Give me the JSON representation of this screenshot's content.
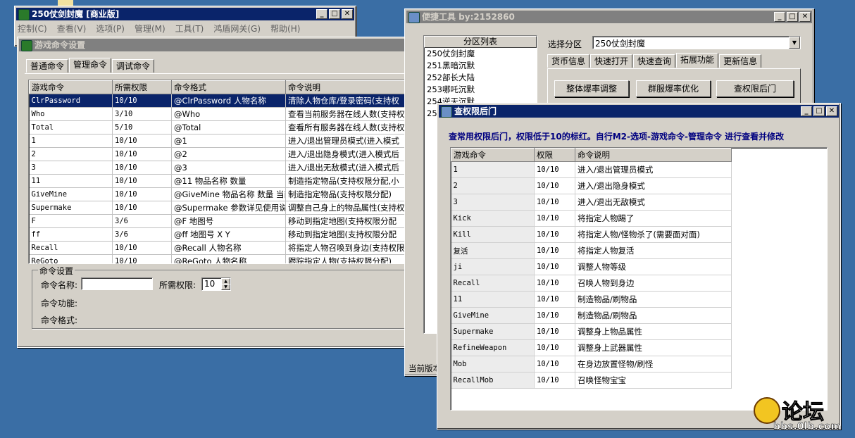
{
  "main_window": {
    "title": "250仗剑封魔 [商业版]",
    "menu": [
      "控制(C)",
      "查看(V)",
      "选项(P)",
      "管理(M)",
      "工具(T)",
      "鸿盾网关(G)",
      "帮助(H)"
    ]
  },
  "cmd_dialog": {
    "title": "游戏命令设置",
    "tabs": [
      "普通命令",
      "管理命令",
      "调试命令"
    ],
    "selected_tab": "管理命令",
    "table": {
      "headers": [
        "游戏命令",
        "所需权限",
        "命令格式",
        "命令说明"
      ],
      "rows": [
        [
          "ClrPassword",
          "10/10",
          "@ClrPassword 人物名称",
          "清除人物仓库/登录密码(支持权"
        ],
        [
          "Who",
          "3/10",
          "@Who",
          "查看当前服务器在线人数(支持权"
        ],
        [
          "Total",
          "5/10",
          "@Total",
          "查看所有服务器在线人数(支持权"
        ],
        [
          "1",
          "10/10",
          "@1",
          "进入/退出管理员模式(进入模式"
        ],
        [
          "2",
          "10/10",
          "@2",
          "进入/退出隐身模式(进入模式后"
        ],
        [
          "3",
          "10/10",
          "@3",
          "进入/退出无敌模式(进入模式后"
        ],
        [
          "11",
          "10/10",
          "@11 物品名称 数量",
          "制造指定物品(支持权限分配,小"
        ],
        [
          "GiveMine",
          "10/10",
          "@GiveMine 物品名称 数量 当前",
          "制造指定物品(支持权限分配)"
        ],
        [
          "Supermake",
          "10/10",
          "@Supermake 参数详见使用说明",
          "调整自己身上的物品属性(支持权"
        ],
        [
          "F",
          "3/6",
          "@F 地图号",
          "移动到指定地图(支持权限分配"
        ],
        [
          "ff",
          "3/6",
          "@ff 地图号 X Y",
          "移动到指定地图(支持权限分配"
        ],
        [
          "Recall",
          "10/10",
          "@Recall 人物名称",
          "将指定人物召唤到身边(支持权限"
        ],
        [
          "ReGoto",
          "10/10",
          "@ReGoto 人物名称",
          "跟踪指定人物(支持权限分配)"
        ]
      ]
    },
    "settings": {
      "group_label": "命令设置",
      "name_label": "命令名称:",
      "name_value": "",
      "perm_label": "所需权限:",
      "perm_value": "10",
      "function_label": "命令功能:",
      "format_label": "命令格式:"
    }
  },
  "tool_window": {
    "title": "便捷工具   by:2152860",
    "partition_list_header": "分区列表",
    "partitions": [
      "250仗剑封魔",
      "251黑暗沉默",
      "252部长大陆",
      "253哪吒沉默",
      "254逆天沉默",
      "25"
    ],
    "select_label": "选择分区",
    "select_value": "250仗剑封魔",
    "tabs": [
      "货币信息",
      "快速打开",
      "快速查询",
      "拓展功能",
      "更新信息"
    ],
    "selected_tab": "拓展功能",
    "buttons": [
      "整体爆率调整",
      "群服爆率优化",
      "查权限后门"
    ],
    "status_text": "当前版本"
  },
  "perm_window": {
    "title": "查权限后门",
    "info": "查常用权限后门，权限低于10的标红。自行M2-选项-游戏命令-管理命令 进行查看并修改",
    "table": {
      "headers": [
        "游戏命令",
        "权限",
        "命令说明"
      ],
      "rows": [
        [
          "1",
          "10/10",
          "进入/退出管理员模式"
        ],
        [
          "2",
          "10/10",
          "进入/退出隐身模式"
        ],
        [
          "3",
          "10/10",
          "进入/退出无敌模式"
        ],
        [
          "Kick",
          "10/10",
          "将指定人物踢了"
        ],
        [
          "Kill",
          "10/10",
          "将指定人物/怪物杀了(需要面对面)"
        ],
        [
          "复活",
          "10/10",
          "将指定人物复活"
        ],
        [
          "ji",
          "10/10",
          "调整人物等级"
        ],
        [
          "Recall",
          "10/10",
          "召唤人物到身边"
        ],
        [
          "11",
          "10/10",
          "制造物品/刷物品"
        ],
        [
          "GiveMine",
          "10/10",
          "制造物品/刷物品"
        ],
        [
          "Supermake",
          "10/10",
          "调整身上物品属性"
        ],
        [
          "RefineWeapon",
          "10/10",
          "调整身上武器属性"
        ],
        [
          "Mob",
          "10/10",
          "在身边放置怪物/刷怪"
        ],
        [
          "RecallMob",
          "10/10",
          "召唤怪物宝宝"
        ]
      ]
    }
  },
  "watermark": {
    "text": "bbs.0lb.com",
    "logo_text": "论坛"
  },
  "window_controls": {
    "minimize": "_",
    "maximize": "□",
    "close": "✕"
  },
  "colors": {
    "title_active": "#0a246a",
    "title_inactive": "#808080",
    "info_text": "#000080",
    "desktop": "#3a6ea5"
  }
}
